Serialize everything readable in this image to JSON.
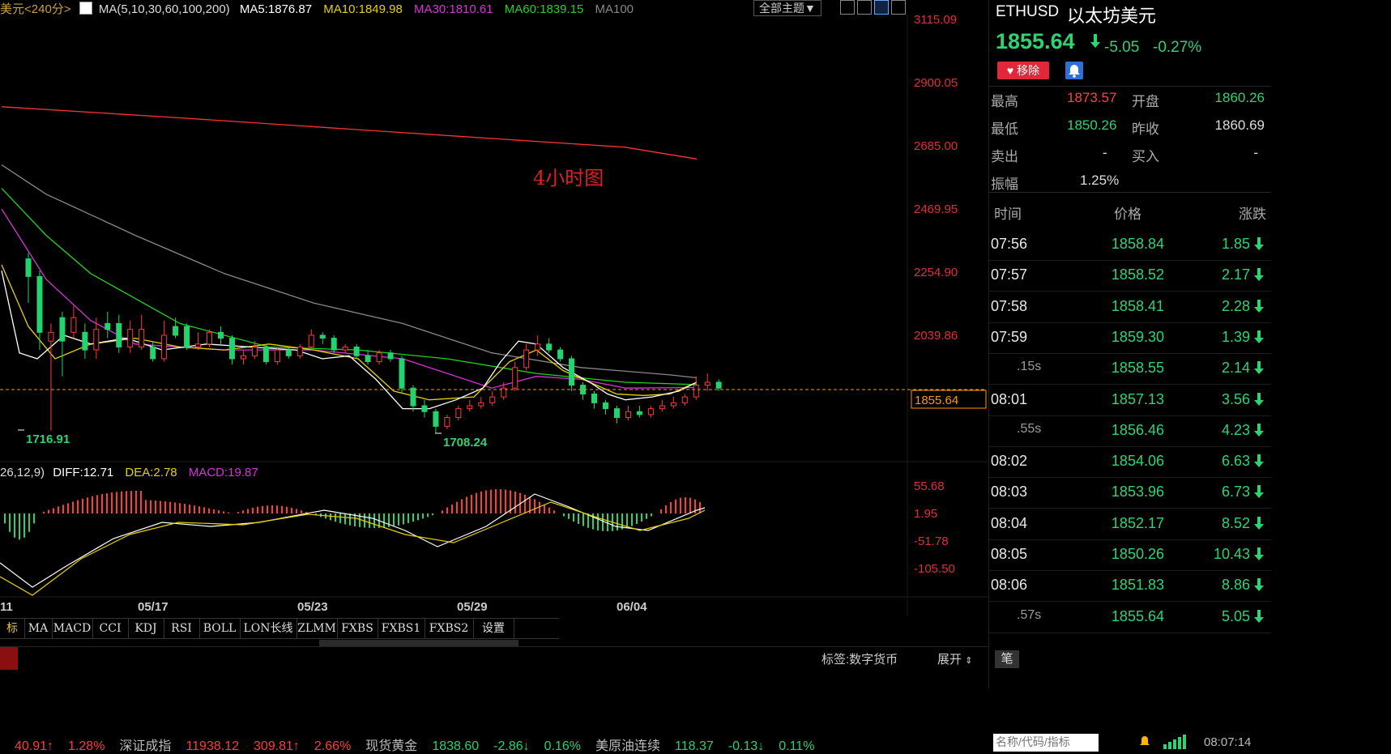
{
  "header": {
    "title_prefix": "美元<240分>",
    "ma_settings": "MA(5,10,30,60,100,200)",
    "ma5": "MA5:1876.87",
    "ma10": "MA10:1849.98",
    "ma30": "MA30:1810.61",
    "ma60": "MA60:1839.15",
    "ma100": "MA100",
    "theme_button": "全部主题▼"
  },
  "colors": {
    "up": "#ff3b3b",
    "down": "#22d36e",
    "ma5": "#ffffff",
    "ma10": "#e6d200",
    "ma30": "#d832d8",
    "ma60": "#1fd41f",
    "ma100": "#888888",
    "ma200": "#ff3333",
    "axis_text": "#e03030",
    "current_price_line": "#ff9a00"
  },
  "chart_data": [
    {
      "type": "candlestick",
      "title": "4小时图",
      "y_ticks": [
        "3115.09",
        "2900.05",
        "2685.00",
        "2469.95",
        "2254.90",
        "2039.86"
      ],
      "ylim": [
        1716,
        3115.09
      ],
      "x_ticks": [
        "11",
        "05/17",
        "05/23",
        "05/29",
        "06/04"
      ],
      "current_price": "1855.64",
      "annotations": [
        {
          "label": "1716.91"
        },
        {
          "label": "1708.24"
        }
      ],
      "ma200_points": [
        [
          0,
          2818
        ],
        [
          20,
          2780
        ],
        [
          40,
          2740
        ],
        [
          60,
          2700
        ],
        [
          70,
          2680
        ],
        [
          78,
          2640
        ]
      ],
      "ma100_points": [
        [
          0,
          2620
        ],
        [
          5,
          2520
        ],
        [
          15,
          2380
        ],
        [
          25,
          2250
        ],
        [
          35,
          2150
        ],
        [
          45,
          2080
        ],
        [
          55,
          1980
        ],
        [
          65,
          1930
        ],
        [
          75,
          1905
        ],
        [
          78,
          1895
        ]
      ],
      "ma60_points": [
        [
          0,
          2540
        ],
        [
          5,
          2380
        ],
        [
          10,
          2250
        ],
        [
          20,
          2080
        ],
        [
          30,
          2000
        ],
        [
          40,
          1990
        ],
        [
          50,
          1960
        ],
        [
          60,
          1910
        ],
        [
          70,
          1880
        ],
        [
          78,
          1872
        ]
      ],
      "ma30_points": [
        [
          0,
          2470
        ],
        [
          5,
          2230
        ],
        [
          10,
          2090
        ],
        [
          15,
          2010
        ],
        [
          25,
          1990
        ],
        [
          35,
          1990
        ],
        [
          45,
          1960
        ],
        [
          55,
          1860
        ],
        [
          60,
          1900
        ],
        [
          65,
          1890
        ],
        [
          70,
          1860
        ],
        [
          78,
          1862
        ]
      ],
      "ma10_points": [
        [
          0,
          2280
        ],
        [
          3,
          2070
        ],
        [
          6,
          1960
        ],
        [
          10,
          2010
        ],
        [
          15,
          2030
        ],
        [
          20,
          2000
        ],
        [
          25,
          1990
        ],
        [
          30,
          2010
        ],
        [
          35,
          1990
        ],
        [
          40,
          1960
        ],
        [
          44,
          1850
        ],
        [
          48,
          1820
        ],
        [
          53,
          1830
        ],
        [
          57,
          1950
        ],
        [
          60,
          1990
        ],
        [
          63,
          1920
        ],
        [
          66,
          1880
        ],
        [
          69,
          1840
        ],
        [
          72,
          1835
        ],
        [
          75,
          1840
        ],
        [
          78,
          1880
        ]
      ],
      "ma5_points": [
        [
          0,
          2260
        ],
        [
          2,
          1980
        ],
        [
          4,
          1960
        ],
        [
          7,
          2040
        ],
        [
          10,
          2010
        ],
        [
          14,
          2030
        ],
        [
          18,
          1990
        ],
        [
          23,
          2010
        ],
        [
          28,
          2000
        ],
        [
          33,
          1990
        ],
        [
          36,
          1960
        ],
        [
          39,
          1970
        ],
        [
          42,
          1890
        ],
        [
          45,
          1790
        ],
        [
          48,
          1790
        ],
        [
          51,
          1820
        ],
        [
          54,
          1860
        ],
        [
          56,
          1950
        ],
        [
          58,
          2020
        ],
        [
          60,
          2010
        ],
        [
          63,
          1930
        ],
        [
          66,
          1880
        ],
        [
          68,
          1840
        ],
        [
          70,
          1820
        ],
        [
          73,
          1830
        ],
        [
          76,
          1850
        ],
        [
          78,
          1880
        ]
      ],
      "candles": [
        [
          0,
          2240,
          2300,
          2150,
          2320,
          1
        ],
        [
          1,
          2050,
          2240,
          1990,
          2260,
          1
        ],
        [
          2,
          2020,
          2050,
          1716,
          2080,
          0
        ],
        [
          3,
          2100,
          2020,
          1900,
          2120,
          1
        ],
        [
          4,
          2050,
          2100,
          2030,
          2140,
          0
        ],
        [
          5,
          1990,
          2050,
          1960,
          2080,
          1
        ],
        [
          6,
          2060,
          1990,
          1960,
          2100,
          0
        ],
        [
          7,
          2080,
          2060,
          2030,
          2120,
          1
        ],
        [
          8,
          2000,
          2080,
          1980,
          2110,
          1
        ],
        [
          9,
          2060,
          2000,
          1980,
          2090,
          0
        ],
        [
          10,
          2000,
          2060,
          1990,
          2110,
          0
        ],
        [
          11,
          1960,
          2000,
          1950,
          2020,
          1
        ],
        [
          12,
          2040,
          1960,
          1950,
          2090,
          0
        ],
        [
          13,
          2070,
          2040,
          2030,
          2100,
          1
        ],
        [
          14,
          2000,
          2070,
          1990,
          2080,
          1
        ],
        [
          15,
          2010,
          2000,
          1990,
          2050,
          0
        ],
        [
          16,
          2050,
          2010,
          2000,
          2060,
          0
        ],
        [
          17,
          2030,
          2050,
          2010,
          2070,
          1
        ],
        [
          18,
          1960,
          2030,
          1940,
          2040,
          1
        ],
        [
          19,
          1970,
          1960,
          1940,
          1990,
          0
        ],
        [
          20,
          2000,
          1970,
          1960,
          2020,
          0
        ],
        [
          21,
          1950,
          2000,
          1940,
          2010,
          1
        ],
        [
          22,
          1990,
          1950,
          1940,
          2000,
          0
        ],
        [
          23,
          1970,
          1990,
          1960,
          2000,
          1
        ],
        [
          24,
          2000,
          1970,
          1960,
          2010,
          0
        ],
        [
          25,
          2040,
          2000,
          1990,
          2060,
          0
        ],
        [
          26,
          2030,
          2040,
          2010,
          2050,
          1
        ],
        [
          27,
          1990,
          2030,
          1980,
          2040,
          1
        ],
        [
          28,
          2000,
          1990,
          1980,
          2010,
          0
        ],
        [
          29,
          1970,
          2000,
          1960,
          2010,
          1
        ],
        [
          30,
          1950,
          1970,
          1940,
          1990,
          1
        ],
        [
          31,
          1980,
          1950,
          1940,
          1990,
          0
        ],
        [
          32,
          1960,
          1980,
          1950,
          1990,
          1
        ],
        [
          33,
          1860,
          1960,
          1840,
          1970,
          1
        ],
        [
          34,
          1800,
          1860,
          1780,
          1870,
          1
        ],
        [
          35,
          1780,
          1800,
          1760,
          1820,
          1
        ],
        [
          36,
          1730,
          1780,
          1708,
          1790,
          1
        ],
        [
          37,
          1760,
          1730,
          1720,
          1770,
          0
        ],
        [
          38,
          1790,
          1760,
          1750,
          1800,
          0
        ],
        [
          39,
          1800,
          1790,
          1780,
          1820,
          0
        ],
        [
          40,
          1810,
          1800,
          1790,
          1830,
          0
        ],
        [
          41,
          1830,
          1810,
          1800,
          1850,
          0
        ],
        [
          42,
          1860,
          1830,
          1820,
          1880,
          0
        ],
        [
          43,
          1930,
          1860,
          1850,
          1950,
          0
        ],
        [
          44,
          1990,
          1930,
          1920,
          2010,
          0
        ],
        [
          45,
          2010,
          1990,
          1970,
          2040,
          0
        ],
        [
          46,
          1990,
          2010,
          1980,
          2030,
          1
        ],
        [
          47,
          1960,
          1990,
          1950,
          2000,
          1
        ],
        [
          48,
          1870,
          1960,
          1850,
          1970,
          1
        ],
        [
          49,
          1840,
          1870,
          1820,
          1880,
          1
        ],
        [
          50,
          1810,
          1840,
          1790,
          1850,
          1
        ],
        [
          51,
          1790,
          1810,
          1770,
          1820,
          1
        ],
        [
          52,
          1760,
          1790,
          1740,
          1800,
          1
        ],
        [
          53,
          1780,
          1760,
          1750,
          1800,
          0
        ],
        [
          54,
          1770,
          1780,
          1760,
          1800,
          1
        ],
        [
          55,
          1790,
          1770,
          1760,
          1800,
          0
        ],
        [
          56,
          1800,
          1790,
          1780,
          1820,
          0
        ],
        [
          57,
          1810,
          1800,
          1790,
          1830,
          0
        ],
        [
          58,
          1830,
          1810,
          1800,
          1840,
          0
        ],
        [
          59,
          1870,
          1830,
          1820,
          1900,
          0
        ],
        [
          60,
          1880,
          1870,
          1850,
          1910,
          0
        ],
        [
          61,
          1860,
          1880,
          1850,
          1890,
          1
        ]
      ],
      "macd_y_ticks": [
        "55.68",
        "1.95",
        "-51.78",
        "-105.50"
      ]
    }
  ],
  "macd": {
    "label_params": "26,12,9)",
    "diff": "DIFF:12.71",
    "dea": "DEA:2.78",
    "macd": "MACD:19.87"
  },
  "indicator_tabs": [
    "标",
    "MA",
    "MACD",
    "CCI",
    "KDJ",
    "RSI",
    "BOLL",
    "LON长线",
    "ZLMM",
    "FXBS",
    "FXBS1",
    "FXBS2",
    "设置"
  ],
  "status": {
    "tag": "标签:数字货币",
    "expand": "展开",
    "pen": "笔"
  },
  "quote": {
    "symbol": "ETHUSD",
    "name": "以太坊美元",
    "price": "1855.64",
    "change": "-5.05",
    "change_pct": "-0.27%",
    "remove_label": "移除",
    "high_label": "最高",
    "high": "1873.57",
    "open_label": "开盘",
    "open": "1860.26",
    "low_label": "最低",
    "low": "1850.26",
    "prev_close_label": "昨收",
    "prev_close": "1860.69",
    "sell_label": "卖出",
    "sell": "-",
    "buy_label": "买入",
    "buy": "-",
    "amplitude_label": "振幅",
    "amplitude": "1.25%"
  },
  "ticks": {
    "headers": [
      "时间",
      "价格",
      "涨跌"
    ],
    "rows": [
      {
        "time": "07:56",
        "price": "1858.84",
        "chg": "1.85",
        "sub": false
      },
      {
        "time": "07:57",
        "price": "1858.52",
        "chg": "2.17",
        "sub": false
      },
      {
        "time": "07:58",
        "price": "1858.41",
        "chg": "2.28",
        "sub": false
      },
      {
        "time": "07:59",
        "price": "1859.30",
        "chg": "1.39",
        "sub": false
      },
      {
        "time": ".15s",
        "price": "1858.55",
        "chg": "2.14",
        "sub": true
      },
      {
        "time": "08:01",
        "price": "1857.13",
        "chg": "3.56",
        "sub": false
      },
      {
        "time": ".55s",
        "price": "1856.46",
        "chg": "4.23",
        "sub": true
      },
      {
        "time": "08:02",
        "price": "1854.06",
        "chg": "6.63",
        "sub": false
      },
      {
        "time": "08:03",
        "price": "1853.96",
        "chg": "6.73",
        "sub": false
      },
      {
        "time": "08:04",
        "price": "1852.17",
        "chg": "8.52",
        "sub": false
      },
      {
        "time": "08:05",
        "price": "1850.26",
        "chg": "10.43",
        "sub": false
      },
      {
        "time": "08:06",
        "price": "1851.83",
        "chg": "8.86",
        "sub": false
      },
      {
        "time": ".57s",
        "price": "1855.64",
        "chg": "5.05",
        "sub": true
      }
    ]
  },
  "ticker": [
    {
      "text": "40.91↑",
      "color": "#ff3b3b"
    },
    {
      "text": "1.28%",
      "color": "#ff3b3b"
    },
    {
      "text": "深证成指",
      "color": "#bbbbbb"
    },
    {
      "text": "11938.12",
      "color": "#ff3b3b"
    },
    {
      "text": "309.81↑",
      "color": "#ff3b3b"
    },
    {
      "text": "2.66%",
      "color": "#ff3b3b"
    },
    {
      "text": "现货黄金",
      "color": "#bbbbbb"
    },
    {
      "text": "1838.60",
      "color": "#22d36e"
    },
    {
      "text": "-2.86↓",
      "color": "#22d36e"
    },
    {
      "text": "0.16%",
      "color": "#22d36e"
    },
    {
      "text": "美原油连续",
      "color": "#bbbbbb"
    },
    {
      "text": "118.37",
      "color": "#22d36e"
    },
    {
      "text": "-0.13↓",
      "color": "#22d36e"
    },
    {
      "text": "0.11%",
      "color": "#22d36e"
    }
  ],
  "search": {
    "placeholder": "名称/代码/指标"
  },
  "clock": "08:07:14"
}
